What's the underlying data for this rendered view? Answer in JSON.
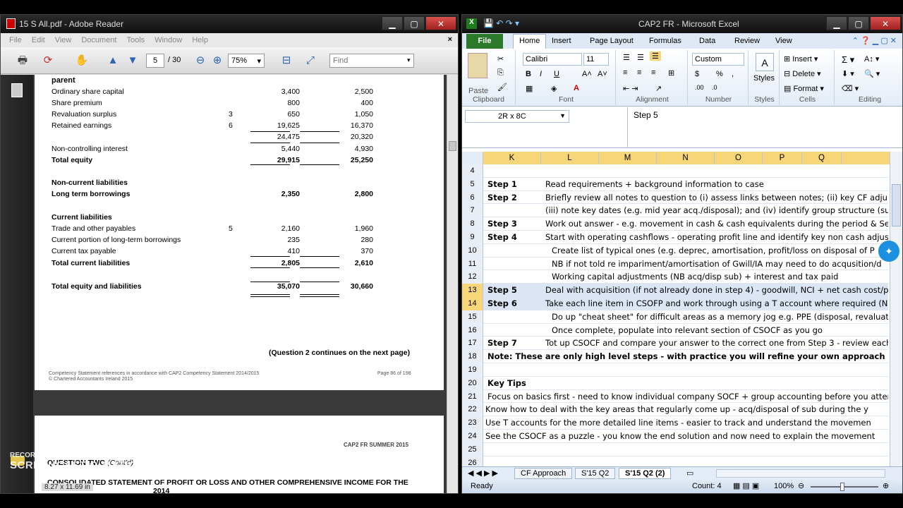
{
  "reader": {
    "title": "15 S All.pdf - Adobe Reader",
    "menu": [
      "File",
      "Edit",
      "View",
      "Document",
      "Tools",
      "Window",
      "Help"
    ],
    "page_current": "5",
    "page_total": "/ 30",
    "zoom": "75%",
    "find_placeholder": "Find",
    "page_size_label": "8.27 x 11.69 in",
    "page1": {
      "heading_parent": "parent",
      "rows": [
        {
          "label": "Ordinary share capital",
          "note": "",
          "v1": "3,400",
          "v2": "2,500",
          "bold": false
        },
        {
          "label": "Share premium",
          "note": "",
          "v1": "800",
          "v2": "400",
          "bold": false
        },
        {
          "label": "Revaluation surplus",
          "note": "3",
          "v1": "650",
          "v2": "1,050",
          "bold": false
        },
        {
          "label": "Retained earnings",
          "note": "6",
          "v1": "19,625",
          "v2": "16,370",
          "bold": false
        },
        {
          "label": "",
          "note": "",
          "v1": "24,475",
          "v2": "20,320",
          "bold": false
        },
        {
          "label": "Non-controlling interest",
          "note": "",
          "v1": "5,440",
          "v2": "4,930",
          "bold": false
        },
        {
          "label": "Total equity",
          "note": "",
          "v1": "29,915",
          "v2": "25,250",
          "bold": true
        },
        {
          "label": "Non-current liabilities",
          "note": "",
          "v1": "",
          "v2": "",
          "bold": true
        },
        {
          "label": "Long term borrowings",
          "note": "",
          "v1": "2,350",
          "v2": "2,800",
          "bold": true
        },
        {
          "label": "Current liabilities",
          "note": "",
          "v1": "",
          "v2": "",
          "bold": true
        },
        {
          "label": "Trade and other payables",
          "note": "5",
          "v1": "2,160",
          "v2": "1,960",
          "bold": false
        },
        {
          "label": "Current portion of long-term borrowings",
          "note": "",
          "v1": "235",
          "v2": "280",
          "bold": false
        },
        {
          "label": "Current tax payable",
          "note": "",
          "v1": "410",
          "v2": "370",
          "bold": false
        },
        {
          "label": "Total current liabilities",
          "note": "",
          "v1": "2,805",
          "v2": "2,610",
          "bold": true
        },
        {
          "label": "Total equity and liabilities",
          "note": "",
          "v1": "35,070",
          "v2": "30,660",
          "bold": true
        }
      ],
      "continues": "(Question 2 continues on the next page)",
      "footer_left_1": "Competency Statement references in accordance with CAP2 Competency Statement 2014/2015",
      "footer_left_2": "© Chartered Accountants Ireland 2015",
      "footer_right": "Page 86 of 198"
    },
    "page2": {
      "header_right": "CAP2 FR SUMMER 2015",
      "question": "QUESTION TWO",
      "contd": "(Cont'd)",
      "statement_title": "CONSOLIDATED STATEMENT OF PROFIT OR LOSS AND OTHER COMPREHENSIVE INCOME FOR THE",
      "year_fragment": "2014"
    }
  },
  "excel": {
    "title": "CAP2 FR  -  Microsoft Excel",
    "tabs": [
      "File",
      "Home",
      "Insert",
      "Page Layout",
      "Formulas",
      "Data",
      "Review",
      "View"
    ],
    "font_name": "Calibri",
    "font_size": "11",
    "number_format": "Custom",
    "groups": [
      "Clipboard",
      "Font",
      "Alignment",
      "Number",
      "Styles",
      "Cells",
      "Editing"
    ],
    "paste_label": "Paste",
    "styles_label": "Styles",
    "cells_buttons": [
      "Insert",
      "Delete",
      "Format"
    ],
    "name_box": "2R x 8C",
    "formula_value": "Step 5",
    "columns": [
      "K",
      "L",
      "M",
      "N",
      "O",
      "P",
      "Q"
    ],
    "rows": [
      {
        "n": "4",
        "k": "",
        "t": "",
        "indent": 0,
        "bold": false,
        "sel": false
      },
      {
        "n": "5",
        "k": "Step 1",
        "t": "Read requirements + background information to case",
        "indent": 0,
        "bold": false,
        "sel": false
      },
      {
        "n": "6",
        "k": "Step 2",
        "t": "Briefly review all notes to question to (i) assess links between notes; (ii) key CF adju",
        "indent": 0,
        "bold": false,
        "sel": false
      },
      {
        "n": "7",
        "k": "",
        "t": "(iii) note key dates (e.g. mid year acq./disposal); and (iv) identify group structure (su",
        "indent": 0,
        "bold": false,
        "sel": false
      },
      {
        "n": "8",
        "k": "Step 3",
        "t": "Work out answer  - e.g. movement in cash & cash equivalents during the period & Se",
        "indent": 0,
        "bold": false,
        "sel": false
      },
      {
        "n": "9",
        "k": "Step 4",
        "t": "Start with operating cashflows - operating profit line and identify key non cash adjus",
        "indent": 0,
        "bold": false,
        "sel": false
      },
      {
        "n": "10",
        "k": "",
        "t": "Create list of typical ones (e.g. deprec, amortisation, profit/loss on disposal of P",
        "indent": 1,
        "bold": false,
        "sel": false
      },
      {
        "n": "11",
        "k": "",
        "t": "NB if not told re impariment/amortisation of Gwill/IA may need to do acqusition/d",
        "indent": 1,
        "bold": false,
        "sel": false
      },
      {
        "n": "12",
        "k": "",
        "t": "Working capital adjustments (NB acq/disp sub) + interest and tax paid",
        "indent": 1,
        "bold": false,
        "sel": false
      },
      {
        "n": "13",
        "k": "Step 5",
        "t": "Deal with acquisition (if not already done in step 4) - goodwill, NCI + net cash cost/pr",
        "indent": 0,
        "bold": false,
        "sel": true
      },
      {
        "n": "14",
        "k": "Step 6",
        "t": "Take each line item in CSOFP and work through using a T account where required (NB",
        "indent": 0,
        "bold": false,
        "sel": true
      },
      {
        "n": "15",
        "k": "",
        "t": "Do up \"cheat sheet\" for difficult areas as a memory jog e.g. PPE (disposal, revaluati",
        "indent": 1,
        "bold": false,
        "sel": false
      },
      {
        "n": "16",
        "k": "",
        "t": "Once complete, populate into relevant section of CSOCF as you go",
        "indent": 1,
        "bold": false,
        "sel": false
      },
      {
        "n": "17",
        "k": "Step 7",
        "t": "Tot up CSOCF and compare your answer to the correct one from Step 3 - review each",
        "indent": 0,
        "bold": false,
        "sel": false
      },
      {
        "n": "18",
        "k": "Note: These are only high level steps - with practice you will refine your own approach",
        "t": "",
        "indent": 0,
        "bold": true,
        "sel": false
      },
      {
        "n": "19",
        "k": "",
        "t": "",
        "indent": 0,
        "bold": false,
        "sel": false
      },
      {
        "n": "20",
        "k": "Key Tips",
        "t": "",
        "indent": 0,
        "bold": true,
        "sel": false
      },
      {
        "n": "21",
        "k": "Focus on basics first - need to know individual company SOCF + group accounting before you attem",
        "t": "",
        "indent": 0,
        "bold": false,
        "sel": false,
        "plain": true
      },
      {
        "n": "22",
        "k": "Know how to deal with the key areas that regularly come up - acq/disposal of sub during the y",
        "t": "",
        "indent": -1,
        "bold": false,
        "sel": false,
        "plain": true
      },
      {
        "n": "23",
        "k": "Use T accounts for the more detailed line items - easier to track and understand the movemen",
        "t": "",
        "indent": -1,
        "bold": false,
        "sel": false,
        "plain": true
      },
      {
        "n": "24",
        "k": "See the CSOCF as a puzzle - you know the end solution and now need to explain the movement",
        "t": "",
        "indent": -1,
        "bold": false,
        "sel": false,
        "plain": true
      },
      {
        "n": "25",
        "k": "",
        "t": "",
        "indent": 0,
        "bold": false,
        "sel": false
      },
      {
        "n": "26",
        "k": "",
        "t": "",
        "indent": 0,
        "bold": false,
        "sel": false
      }
    ],
    "sheet_tabs": [
      "CF Approach",
      "S'15 Q2",
      "S'15 Q2  (2)"
    ],
    "status_ready": "Ready",
    "status_count": "Count: 4",
    "zoom": "100%"
  },
  "watermark": {
    "line1": "RECORDED WITH",
    "line2": "SCREENCAST-O-MATIC"
  }
}
